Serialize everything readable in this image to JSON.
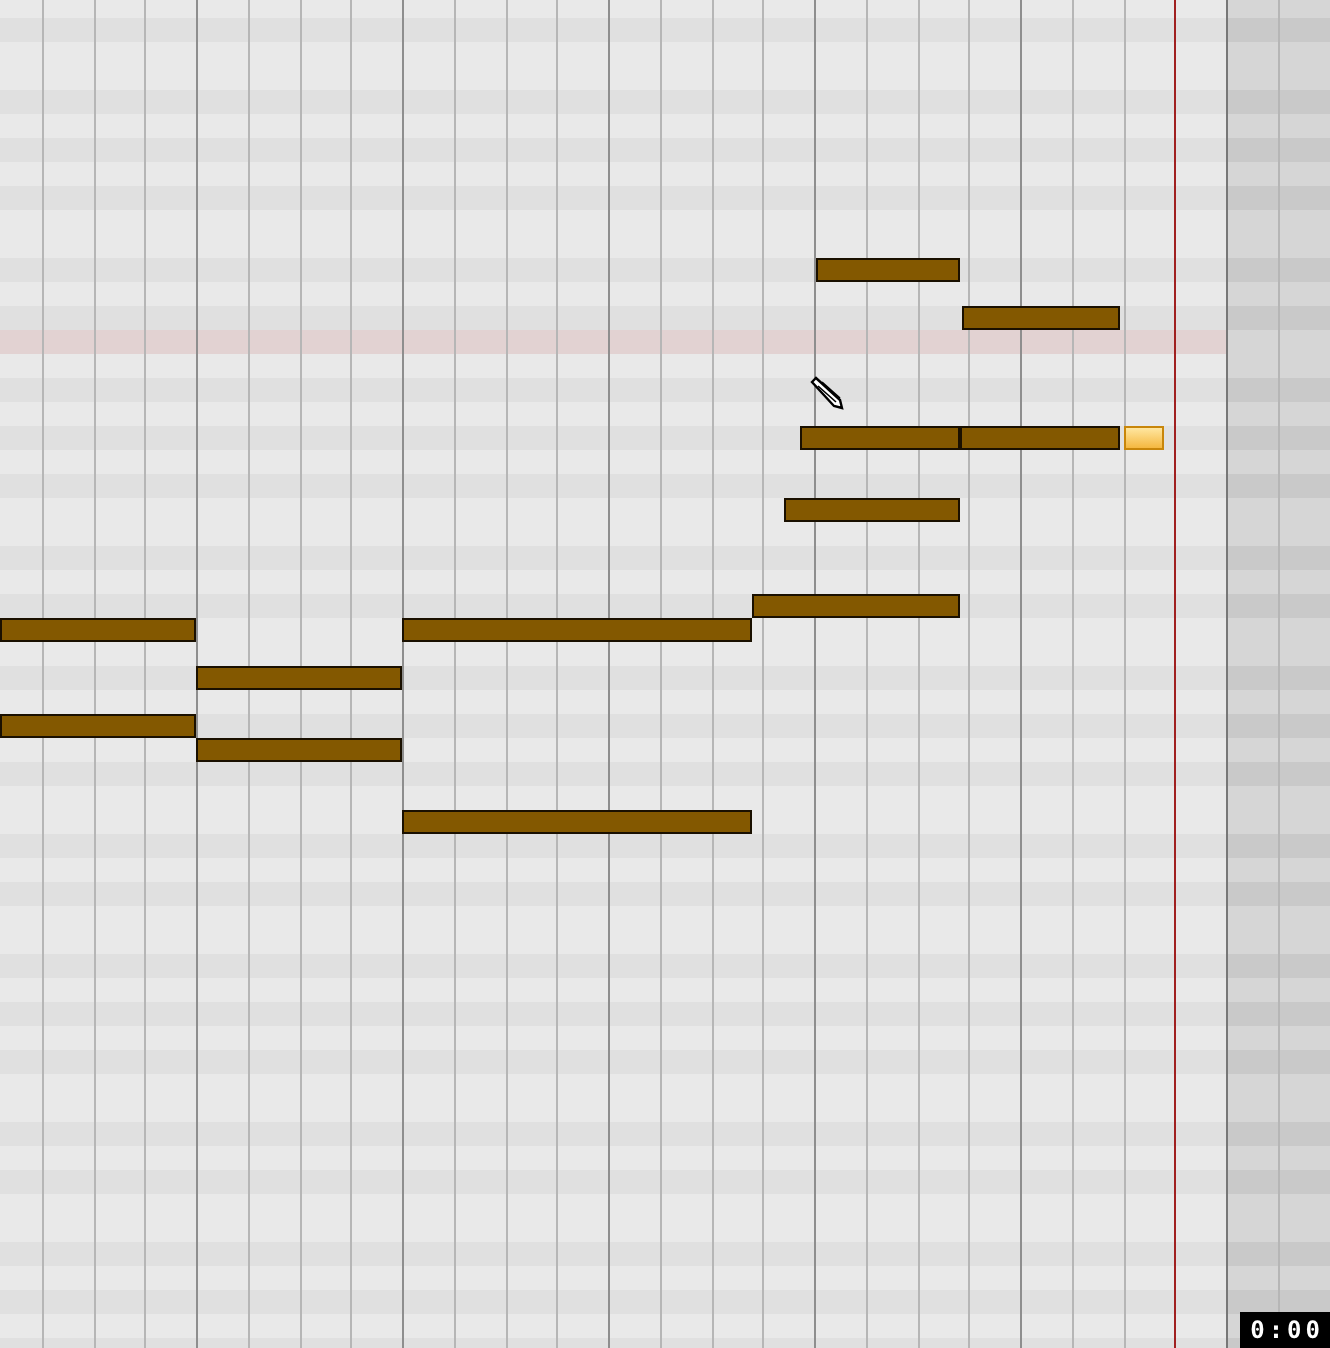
{
  "notes": [
    {
      "selected": false
    },
    {
      "selected": false
    },
    {
      "selected": false
    },
    {
      "selected": false
    },
    {
      "selected": true
    },
    {
      "selected": false
    },
    {
      "selected": false
    },
    {
      "selected": false
    },
    {
      "selected": false
    },
    {
      "selected": false
    },
    {
      "selected": false
    },
    {
      "selected": false
    },
    {
      "selected": false
    }
  ],
  "time_display": "0:00"
}
